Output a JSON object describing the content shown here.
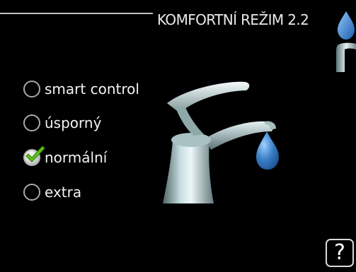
{
  "header": {
    "title": "KOMFORTNÍ REŽIM 2.2"
  },
  "options": [
    {
      "label": "smart control",
      "selected": false
    },
    {
      "label": "úsporný",
      "selected": false
    },
    {
      "label": "normální",
      "selected": true
    },
    {
      "label": "extra",
      "selected": false
    }
  ],
  "help": {
    "label": "?"
  },
  "icons": {
    "corner": "water-drop-faucet-icon",
    "illustration": "faucet-illustration",
    "selected_mark": "green-check-icon"
  },
  "colors": {
    "background": "#000000",
    "text": "#f2f2f2",
    "radio_border": "#a8a8a8",
    "check_green": "#5cc21b",
    "drop_blue": "#3d7fc4"
  }
}
